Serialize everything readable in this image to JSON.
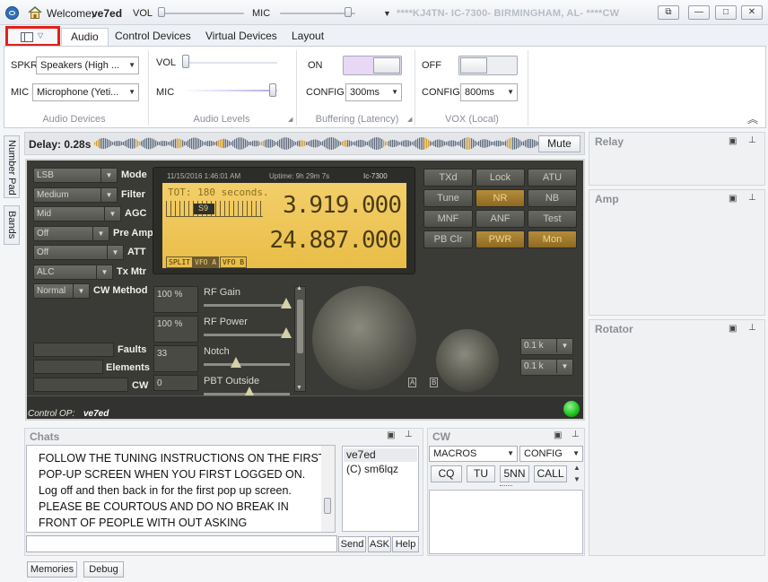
{
  "titlebar": {
    "welcome_prefix": "Welcome,",
    "username": "ve7ed",
    "vol_label": "VOL",
    "mic_label": "MIC",
    "station": "****KJ4TN- IC-7300- BIRMINGHAM, AL- ****CW",
    "vol_level": 0.0,
    "mic_level": 0.95
  },
  "ribbon": {
    "tabs": [
      "Audio",
      "Control Devices",
      "Virtual Devices",
      "Layout"
    ],
    "active_tab": "Audio",
    "audio_devices": {
      "spkr_label": "SPKR",
      "spkr_value": "Speakers (High ...",
      "mic_label": "MIC",
      "mic_value": "Microphone (Yeti...",
      "group_label": "Audio Devices"
    },
    "audio_levels": {
      "vol_label": "VOL",
      "mic_label": "MIC",
      "vol_level": 0.0,
      "mic_level": 0.95,
      "group_label": "Audio Levels"
    },
    "buffering": {
      "toggle_state": "ON",
      "config_label": "CONFIG",
      "config_value": "300ms",
      "group_label": "Buffering (Latency)"
    },
    "vox": {
      "toggle_state": "OFF",
      "config_label": "CONFIG",
      "config_value": "800ms",
      "group_label": "VOX (Local)"
    }
  },
  "side_tabs": [
    "Number Pad",
    "Bands"
  ],
  "delay": {
    "label": "Delay: 0.28s",
    "mute_label": "Mute"
  },
  "radio": {
    "left_controls": [
      {
        "value": "LSB",
        "label": "Mode"
      },
      {
        "value": "Medium",
        "label": "Filter"
      },
      {
        "value": "Mid",
        "label": "AGC"
      },
      {
        "value": "Off",
        "label": "Pre Amp"
      },
      {
        "value": "Off",
        "label": "ATT"
      },
      {
        "value": "ALC",
        "label": "Tx Mtr"
      },
      {
        "value": "Normal",
        "label": "CW Method"
      }
    ],
    "status_labels": [
      "Faults",
      "Elements",
      "CW"
    ],
    "lcd": {
      "date": "11/15/2016 1:46:01 AM",
      "uptime": "Uptime: 9h 29m 7s",
      "model": "Ic-7300",
      "tot": "TOT: 180 seconds.",
      "s_meter": "S9",
      "freq_a": "3.919.000",
      "freq_b": "24.887.000",
      "flags": [
        "SPLIT",
        "VFO A",
        "VFO B"
      ]
    },
    "right_buttons": [
      {
        "label": "TXd",
        "on": false
      },
      {
        "label": "Lock",
        "on": false
      },
      {
        "label": "ATU",
        "on": false
      },
      {
        "label": "Tune",
        "on": false
      },
      {
        "label": "NR",
        "on": true
      },
      {
        "label": "NB",
        "on": false
      },
      {
        "label": "MNF",
        "on": false
      },
      {
        "label": "ANF",
        "on": false
      },
      {
        "label": "Test",
        "on": false
      },
      {
        "label": "PB Clr",
        "on": false
      },
      {
        "label": "PWR",
        "on": true
      },
      {
        "label": "Mon",
        "on": true
      }
    ],
    "sliders": [
      {
        "value": "100 %",
        "label": "RF Gain",
        "level": 0.95
      },
      {
        "value": "100 %",
        "label": "RF Power",
        "level": 0.95
      },
      {
        "value": "33",
        "label": "Notch",
        "level": 0.33
      },
      {
        "value": "0",
        "label": "PBT Outside",
        "level": 0.5
      }
    ],
    "steps": [
      "0.1 k",
      "0.1 k"
    ],
    "knob_a": "A",
    "knob_b": "B",
    "control_op_label": "Control OP:",
    "control_op_user": "ve7ed"
  },
  "chats": {
    "title": "Chats",
    "message": "FOLLOW THE TUNING INSTRUCTIONS ON THE FIRST POP-UP SCREEN WHEN YOU FIRST LOGGED ON. Log off and then back in for the first pop up screen. PLEASE BE COURTOUS AND DO NO BREAK IN FRONT OF PEOPLE WITH OUT ASKING",
    "users": [
      "ve7ed",
      "(C) sm6lqz"
    ],
    "send_label": "Send",
    "ask_label": "ASK",
    "help_label": "Help"
  },
  "cw": {
    "title": "CW",
    "macros_label": "MACROS",
    "config_label": "CONFIG",
    "buttons": [
      "CQ",
      "TU",
      "5NN",
      "CALL"
    ]
  },
  "right_panels": [
    "Relay",
    "Amp",
    "Rotator"
  ],
  "bottom_tabs": [
    "Memories",
    "Debug"
  ],
  "colors": {
    "accent_red": "#e0201c",
    "lcd_amber": "#efc75a",
    "status_green": "#19c11b"
  }
}
